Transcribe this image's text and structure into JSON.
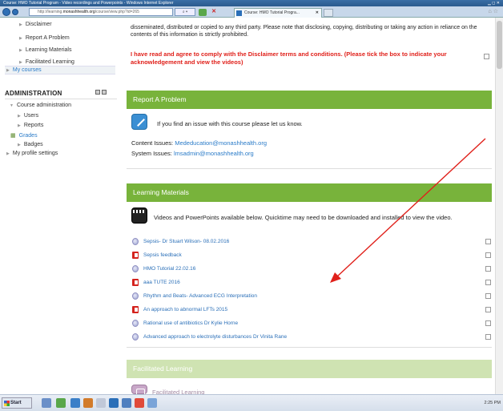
{
  "window": {
    "title": "Course: HMO Tutorial Program - Video recordings and Powerpoints - Windows Internet Explorer",
    "url_prefix": "http://learning.",
    "url_host": "monashhealth.org",
    "url_path": "/course/view.php?id=265",
    "tab_label": "Course: HMO Tutorial Progra..."
  },
  "sidebar": {
    "items": [
      {
        "label": "Disclaimer"
      },
      {
        "label": "Report A Problem"
      },
      {
        "label": "Learning Materials"
      },
      {
        "label": "Facilitated Learning"
      }
    ],
    "my_courses": "My courses",
    "admin_title": "ADMINISTRATION",
    "admin_items": [
      {
        "label": "Course administration"
      },
      {
        "label": "Users"
      },
      {
        "label": "Reports"
      },
      {
        "label": "Grades"
      },
      {
        "label": "Badges"
      },
      {
        "label": "My profile settings"
      }
    ]
  },
  "disclaimer": {
    "text": "disseminated, distributed or copied to any third party. Please note that disclosing, copying, distributing or taking any action in reliance on the contents of this information is strictly prohibited.",
    "agree": "I have read and agree to comply with the Disclaimer terms and conditions. (Please tick the box to indicate your acknowledgement and view the videos)"
  },
  "report": {
    "title": "Report A Problem",
    "intro": "If you find an issue with this course please let us know.",
    "content_label": "Content Issues:",
    "content_email": "Mededucation@monashhealth.org",
    "system_label": "System Issues:",
    "system_email": "lmsadmin@monashhealth.org"
  },
  "learning": {
    "title": "Learning Materials",
    "intro": "Videos and PowerPoints available below. Quicktime may need to be downloaded and installed to view the video.",
    "items": [
      {
        "label": "Sepsis- Dr Stuart Wilson- 08.02.2016",
        "icon": "video-icon"
      },
      {
        "label": "Sepsis feedback",
        "icon": "powerpoint-icon"
      },
      {
        "label": "HMO Tutorial 22.02.16",
        "icon": "video-icon"
      },
      {
        "label": "aaa TUTE 2016",
        "icon": "powerpoint-icon"
      },
      {
        "label": "Rhythm and Beats- Advanced ECG Interpretation",
        "icon": "video-icon"
      },
      {
        "label": "An approach to abnormal LFTs 2015",
        "icon": "powerpoint-icon"
      },
      {
        "label": "Rational use of antibiotics Dr Kylie Horne",
        "icon": "video-icon"
      },
      {
        "label": "Advanced approach to electrolyte disturbances Dr Vinita Rane",
        "icon": "video-icon"
      }
    ]
  },
  "facilitated": {
    "title": "Facilitated Learning",
    "item": "Facilitated Learning"
  },
  "taskbar": {
    "start": "Start",
    "clock": "2:25 PM"
  },
  "colors": {
    "section_green": "#78b33b",
    "warning_red": "#e0201a",
    "link_blue": "#2a6fb8"
  }
}
